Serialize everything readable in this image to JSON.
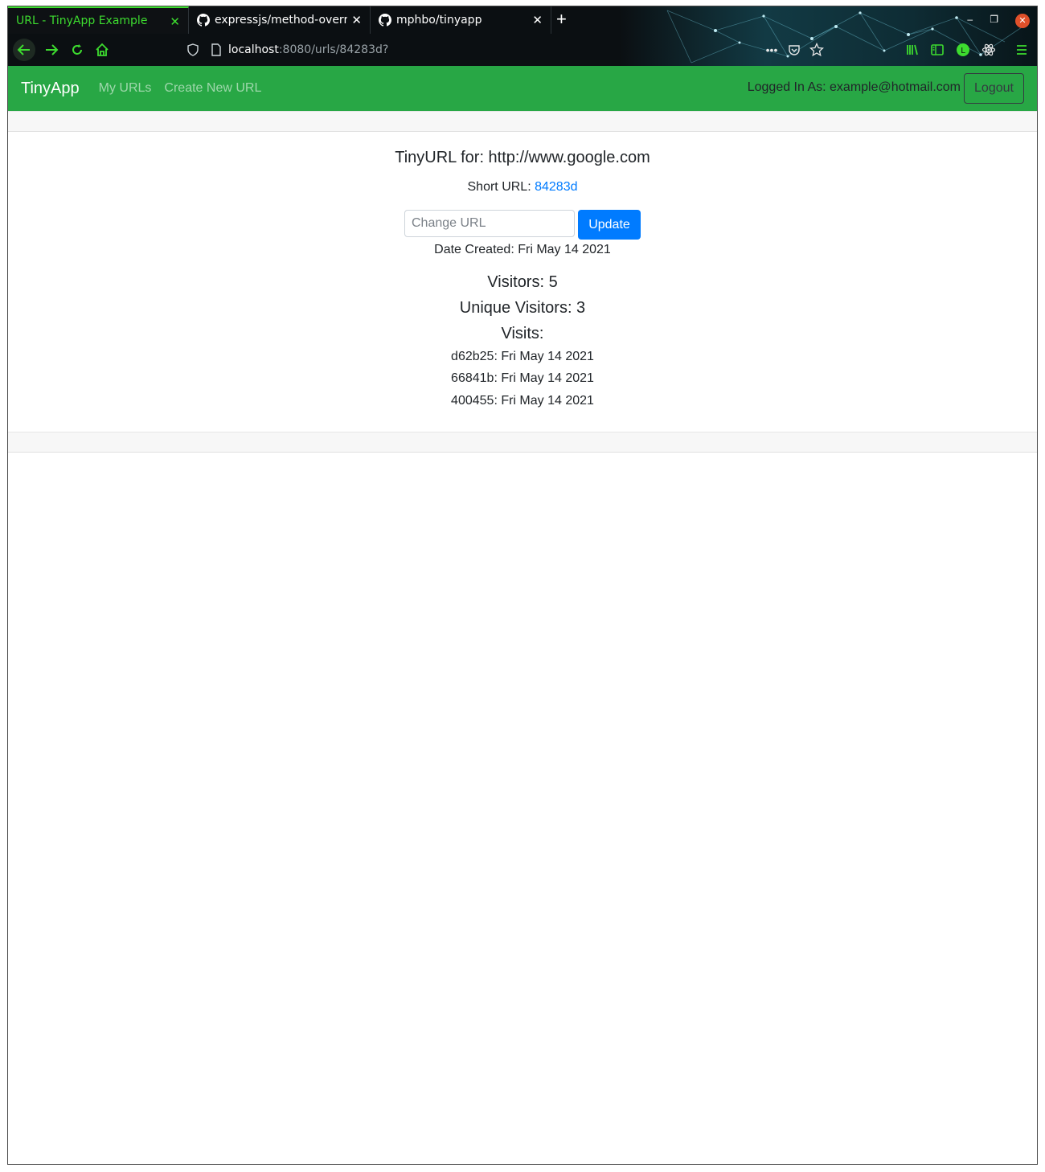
{
  "browser": {
    "tabs": [
      {
        "title": "URL - TinyApp Example",
        "active": true
      },
      {
        "title": "expressjs/method-overri",
        "active": false
      },
      {
        "title": "mphbo/tinyapp",
        "active": false
      }
    ],
    "url_host": "localhost",
    "url_rest": ":8080/urls/84283d?",
    "accent_color": "#3ddc2f"
  },
  "nav": {
    "brand": "TinyApp",
    "links": [
      "My URLs",
      "Create New URL"
    ],
    "logged_in_text": "Logged In As: example@hotmail.com",
    "logout_label": "Logout",
    "bar_color": "#28a745"
  },
  "main": {
    "title": "TinyURL for: http://www.google.com",
    "short_url_label": "Short URL:",
    "short_url_value": "84283d",
    "change_url_placeholder": "Change URL",
    "update_label": "Update",
    "date_created": "Date Created: Fri May 14 2021",
    "visitors": "Visitors: 5",
    "unique_visitors": "Unique Visitors: 3",
    "visits_heading": "Visits:",
    "visits": [
      "d62b25: Fri May 14 2021",
      "66841b: Fri May 14 2021",
      "400455: Fri May 14 2021"
    ]
  }
}
